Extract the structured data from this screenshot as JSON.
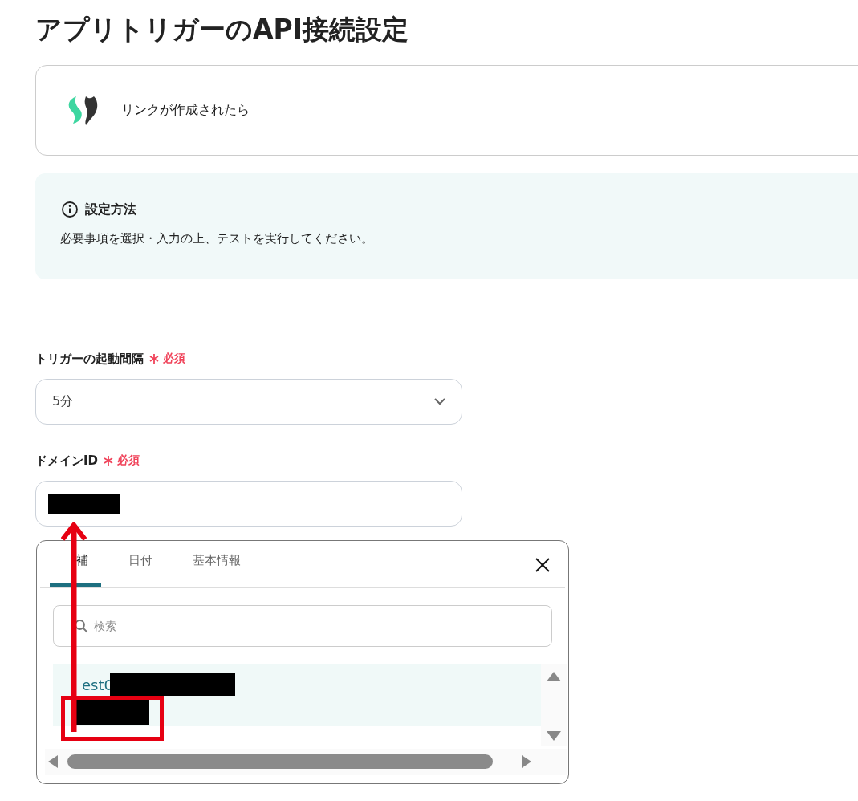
{
  "page_title": "アプリトリガーのAPI接続設定",
  "trigger_card": {
    "label": "リンクが作成されたら"
  },
  "info_box": {
    "title": "設定方法",
    "text": "必要事項を選択・入力の上、テストを実行してください。"
  },
  "fields": [
    {
      "kind": "select",
      "label": "トリガーの起動間隔",
      "required": "必須",
      "value": "5分"
    },
    {
      "kind": "input",
      "label": "ドメインID",
      "required": "必須",
      "redacted": true
    }
  ],
  "popup": {
    "tabs": [
      {
        "label": "補",
        "selected": true
      },
      {
        "label": "日付",
        "selected": false
      },
      {
        "label": "基本情報",
        "selected": false
      }
    ],
    "search": {
      "placeholder": "検索"
    },
    "options": [
      {
        "title": "est0",
        "redacted": true,
        "selected": true
      }
    ]
  }
}
